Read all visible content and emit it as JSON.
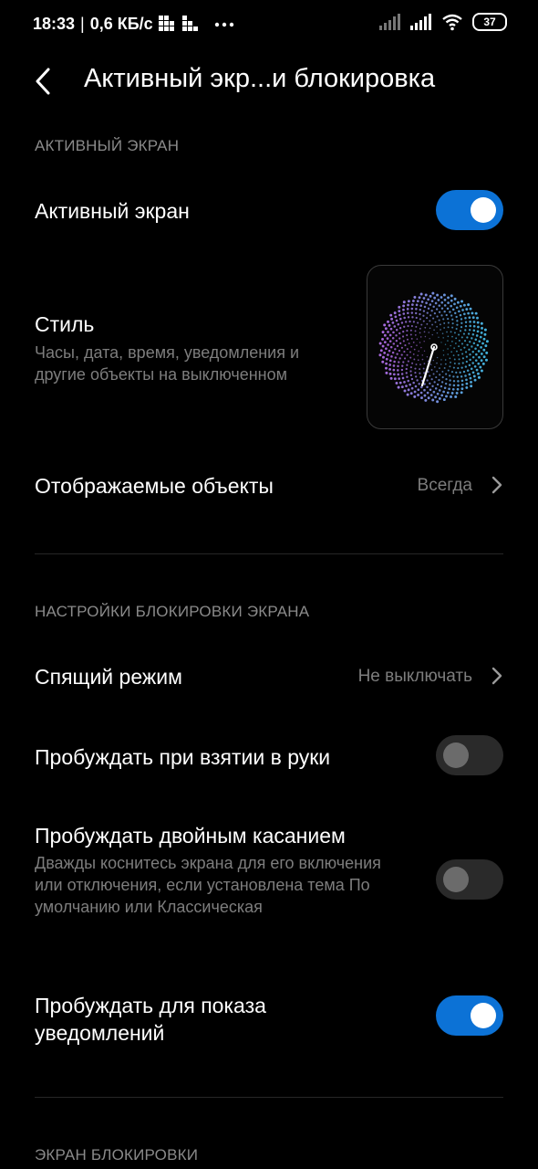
{
  "status_bar": {
    "time": "18:33",
    "separator": "|",
    "speed": "0,6 КБ/с",
    "battery": "37"
  },
  "header": {
    "title": "Активный экр...и блокировка"
  },
  "sections": {
    "active_screen": "АКТИВНЫЙ ЭКРАН",
    "lock_settings": "НАСТРОЙКИ БЛОКИРОВКИ ЭКРАНА",
    "lock_screen": "ЭКРАН БЛОКИРОВКИ"
  },
  "rows": {
    "active_screen": {
      "label": "Активный экран",
      "enabled": true
    },
    "style": {
      "label": "Стиль",
      "subtitle": "Часы, дата, время, уведомления и другие объекты на выключенном"
    },
    "displayed_objects": {
      "label": "Отображаемые объекты",
      "value": "Всегда"
    },
    "sleep_mode": {
      "label": "Спящий режим",
      "value": "Не выключать"
    },
    "wake_on_pickup": {
      "label": "Пробуждать при взятии в руки",
      "enabled": false
    },
    "wake_double_tap": {
      "label": "Пробуждать двойным касанием",
      "subtitle": "Дважды коснитесь экрана для его включения или отключения, если установлена тема По умолчанию или Классическая",
      "enabled": false
    },
    "wake_notifications": {
      "label": "Пробуждать для показа уведомлений",
      "enabled": true
    }
  },
  "colors": {
    "accent": "#0c72d6",
    "background": "#000000",
    "secondary_text": "#7d7d7d"
  }
}
